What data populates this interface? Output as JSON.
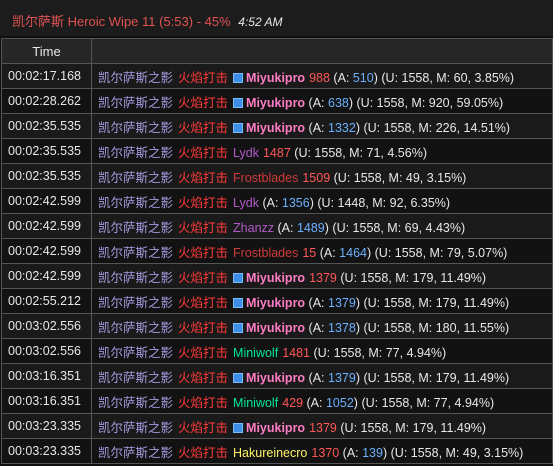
{
  "header": {
    "encounter": "凯尔萨斯 Heroic Wipe 11 (5:53) - 45%",
    "clock": "4:52 AM"
  },
  "table": {
    "col_time": "Time",
    "col_event": ""
  },
  "rows": [
    {
      "time": "00:02:17.168",
      "source": "凯尔萨斯之影",
      "ability": "火焰打击",
      "icon": true,
      "target": "Miyukipro",
      "target_class": "mage",
      "amount": "988",
      "absorb": "510",
      "details": "(U: 1558, M: 60, 3.85%)"
    },
    {
      "time": "00:02:28.262",
      "source": "凯尔萨斯之影",
      "ability": "火焰打击",
      "icon": true,
      "target": "Miyukipro",
      "target_class": "mage",
      "amount": "",
      "absorb": "638",
      "details": "(U: 1558, M: 920, 59.05%)"
    },
    {
      "time": "00:02:35.535",
      "source": "凯尔萨斯之影",
      "ability": "火焰打击",
      "icon": true,
      "target": "Miyukipro",
      "target_class": "mage",
      "amount": "",
      "absorb": "1332",
      "details": "(U: 1558, M: 226, 14.51%)"
    },
    {
      "time": "00:02:35.535",
      "source": "凯尔萨斯之影",
      "ability": "火焰打击",
      "icon": false,
      "target": "Lydk",
      "target_class": "dh",
      "amount": "1487",
      "absorb": "",
      "details": "(U: 1558, M: 71, 4.56%)"
    },
    {
      "time": "00:02:35.535",
      "source": "凯尔萨斯之影",
      "ability": "火焰打击",
      "icon": false,
      "target": "Frostblades",
      "target_class": "dk",
      "amount": "1509",
      "absorb": "",
      "details": "(U: 1558, M: 49, 3.15%)"
    },
    {
      "time": "00:02:42.599",
      "source": "凯尔萨斯之影",
      "ability": "火焰打击",
      "icon": false,
      "target": "Lydk",
      "target_class": "dh",
      "amount": "",
      "absorb": "1356",
      "details": "(U: 1448, M: 92, 6.35%)"
    },
    {
      "time": "00:02:42.599",
      "source": "凯尔萨斯之影",
      "ability": "火焰打击",
      "icon": false,
      "target": "Zhanzz",
      "target_class": "dh",
      "amount": "",
      "absorb": "1489",
      "details": "(U: 1558, M: 69, 4.43%)"
    },
    {
      "time": "00:02:42.599",
      "source": "凯尔萨斯之影",
      "ability": "火焰打击",
      "icon": false,
      "target": "Frostblades",
      "target_class": "dk",
      "amount": "15",
      "absorb": "1464",
      "details": "(U: 1558, M: 79, 5.07%)"
    },
    {
      "time": "00:02:42.599",
      "source": "凯尔萨斯之影",
      "ability": "火焰打击",
      "icon": true,
      "target": "Miyukipro",
      "target_class": "mage",
      "amount": "1379",
      "absorb": "",
      "details": "(U: 1558, M: 179, 11.49%)"
    },
    {
      "time": "00:02:55.212",
      "source": "凯尔萨斯之影",
      "ability": "火焰打击",
      "icon": true,
      "target": "Miyukipro",
      "target_class": "mage",
      "amount": "",
      "absorb": "1379",
      "details": "(U: 1558, M: 179, 11.49%)"
    },
    {
      "time": "00:03:02.556",
      "source": "凯尔萨斯之影",
      "ability": "火焰打击",
      "icon": true,
      "target": "Miyukipro",
      "target_class": "mage",
      "amount": "",
      "absorb": "1378",
      "details": "(U: 1558, M: 180, 11.55%)"
    },
    {
      "time": "00:03:02.556",
      "source": "凯尔萨斯之影",
      "ability": "火焰打击",
      "icon": false,
      "target": "Miniwolf",
      "target_class": "monk",
      "amount": "1481",
      "absorb": "",
      "details": "(U: 1558, M: 77, 4.94%)"
    },
    {
      "time": "00:03:16.351",
      "source": "凯尔萨斯之影",
      "ability": "火焰打击",
      "icon": true,
      "target": "Miyukipro",
      "target_class": "mage",
      "amount": "",
      "absorb": "1379",
      "details": "(U: 1558, M: 179, 11.49%)"
    },
    {
      "time": "00:03:16.351",
      "source": "凯尔萨斯之影",
      "ability": "火焰打击",
      "icon": false,
      "target": "Miniwolf",
      "target_class": "monk",
      "amount": "429",
      "absorb": "1052",
      "details": "(U: 1558, M: 77, 4.94%)"
    },
    {
      "time": "00:03:23.335",
      "source": "凯尔萨斯之影",
      "ability": "火焰打击",
      "icon": true,
      "target": "Miyukipro",
      "target_class": "mage",
      "amount": "1379",
      "absorb": "",
      "details": "(U: 1558, M: 179, 11.49%)"
    },
    {
      "time": "00:03:23.335",
      "source": "凯尔萨斯之影",
      "ability": "火焰打击",
      "icon": false,
      "target": "Hakureinecro",
      "target_class": "rogue",
      "amount": "1370",
      "absorb": "139",
      "details": "(U: 1558, M: 49, 3.15%)"
    }
  ],
  "colors": {
    "source": "#a79ae0",
    "ability": "#ff3a3a",
    "mage": "#ff7dc4",
    "dh": "#b25ac8",
    "dk": "#d03a3a",
    "monk": "#00e896",
    "rogue": "#fff26b",
    "absorb": "#6cb0ff",
    "amount": "#ff5757"
  },
  "icons": {
    "spell": "ability-icon"
  }
}
